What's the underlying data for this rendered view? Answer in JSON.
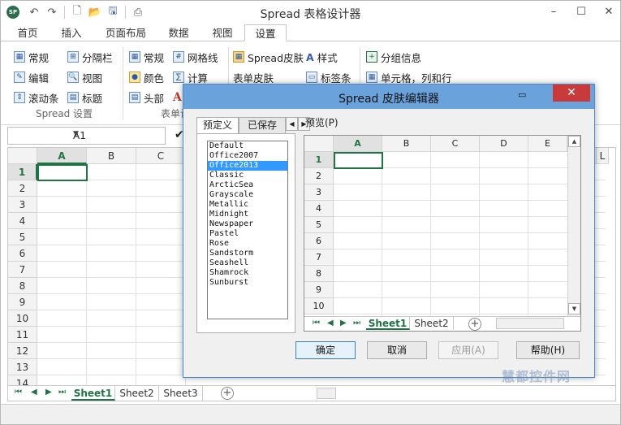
{
  "window": {
    "title": "Spread 表格设计器"
  },
  "quick_access": [
    "undo-icon",
    "redo-icon",
    "new-icon",
    "open-icon",
    "save-icon",
    "print-icon"
  ],
  "tabs": [
    {
      "label": "首页"
    },
    {
      "label": "插入"
    },
    {
      "label": "页面布局"
    },
    {
      "label": "数据"
    },
    {
      "label": "视图"
    },
    {
      "label": "设置"
    }
  ],
  "ribbon": {
    "spread_settings": {
      "items": [
        "常规",
        "分隔栏",
        "编辑",
        "视图",
        "滚动条",
        "标题"
      ],
      "label": "Spread 设置"
    },
    "sheet_settings": {
      "items": [
        "常规",
        "网格线",
        "颜色",
        "计算",
        "头部",
        "A"
      ],
      "label": "表单设"
    },
    "skin": {
      "items": [
        "Spread皮肤",
        "样式",
        "表单皮肤",
        "标签条"
      ]
    },
    "group": {
      "items": [
        "分组信息",
        "单元格，列和行"
      ]
    }
  },
  "formula": {
    "namebox": "A1"
  },
  "grid": {
    "columns": [
      "A",
      "B",
      "C"
    ],
    "rows": [
      "1",
      "2",
      "3",
      "4",
      "5",
      "6",
      "7",
      "8",
      "9",
      "10",
      "11",
      "12",
      "13",
      "14"
    ],
    "right_column": "L"
  },
  "sheets": [
    "Sheet1",
    "Sheet2",
    "Sheet3"
  ],
  "dialog": {
    "title": "Spread 皮肤编辑器",
    "tabs": [
      "预定义",
      "已保存"
    ],
    "skins": [
      "Default",
      "Office2007",
      "Office2013",
      "Classic",
      "ArcticSea",
      "Grayscale",
      "Metallic",
      "Midnight",
      "Newspaper",
      "Pastel",
      "Rose",
      "Sandstorm",
      "Seashell",
      "Shamrock",
      "Sunburst"
    ],
    "selected_skin": "Office2013",
    "preview_label": "预览(P)",
    "preview": {
      "columns": [
        "A",
        "B",
        "C",
        "D",
        "E"
      ],
      "rows": [
        "1",
        "2",
        "3",
        "4",
        "5",
        "6",
        "7",
        "8",
        "9",
        "10"
      ],
      "sheets": [
        "Sheet1",
        "Sheet2"
      ]
    },
    "buttons": {
      "ok": "确定",
      "cancel": "取消",
      "apply": "应用(A)",
      "help": "帮助(H)"
    }
  },
  "watermark": "慧都控件网"
}
